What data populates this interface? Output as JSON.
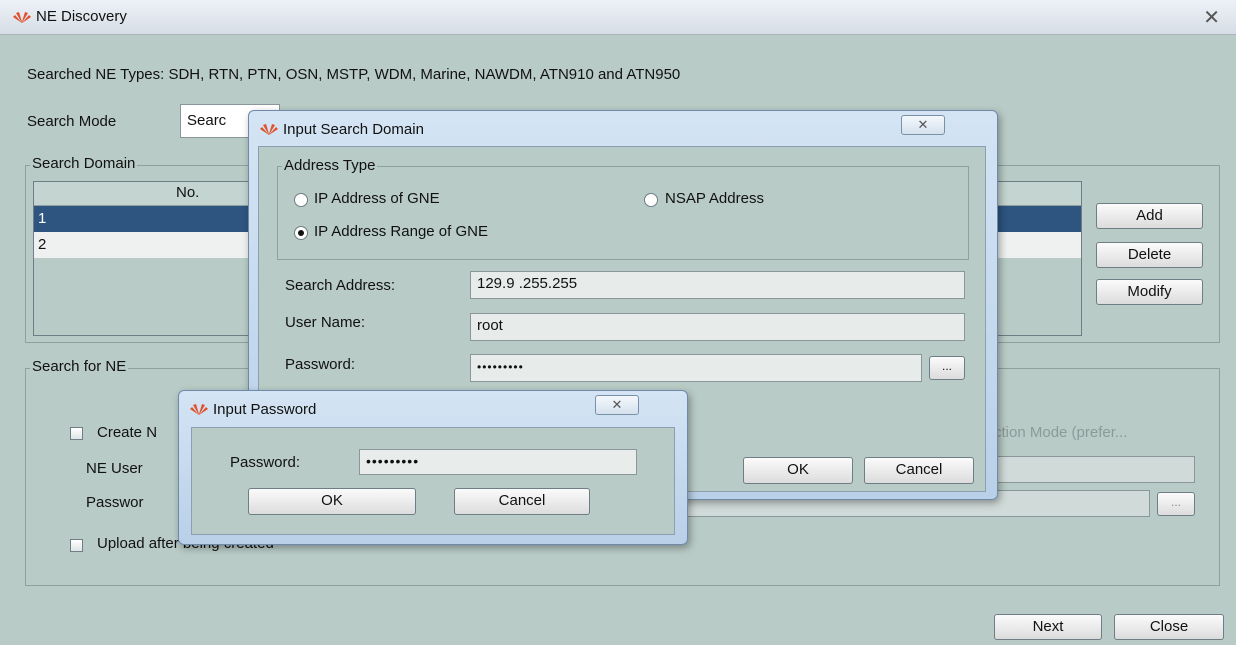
{
  "window": {
    "title": "NE Discovery",
    "close_glyph": "✕"
  },
  "main": {
    "searched_types": "Searched NE Types: SDH, RTN, PTN, OSN, MSTP, WDM, Marine, NAWDM, ATN910 and ATN950",
    "search_mode_label": "Search Mode",
    "search_mode_value": "Searc",
    "search_domain": {
      "label": "Search Domain",
      "column_header": "No.",
      "rows": [
        "1",
        "2"
      ],
      "buttons": {
        "add": "Add",
        "delete": "Delete",
        "modify": "Modify"
      }
    },
    "search_for_ne": {
      "label": "Search for NE",
      "create_checkbox": "Create N",
      "ne_user_label": "NE User",
      "password_label": "Passwor",
      "upload_checkbox": "Upload after being created",
      "partial_right_text": "ction Mode (prefer...",
      "ellipsis": "..."
    },
    "buttons": {
      "next": "Next",
      "close": "Close"
    }
  },
  "search_domain_dialog": {
    "title": "Input Search Domain",
    "close_glyph": "✕",
    "address_type_label": "Address Type",
    "options": {
      "ip_gne": "IP Address of GNE",
      "nsap": "NSAP Address",
      "ip_range": "IP Address Range of GNE"
    },
    "selected_option": "ip_range",
    "search_address_label": "Search Address:",
    "search_address_value": "129.9  .255.255",
    "user_name_label": "User Name:",
    "user_name_value": "root",
    "password_label": "Password:",
    "password_value": "•••••••••",
    "ellipsis": "...",
    "ok": "OK",
    "cancel": "Cancel"
  },
  "password_dialog": {
    "title": "Input Password",
    "close_glyph": "✕",
    "password_label": "Password:",
    "password_value": "•••••••••",
    "ok": "OK",
    "cancel": "Cancel"
  }
}
